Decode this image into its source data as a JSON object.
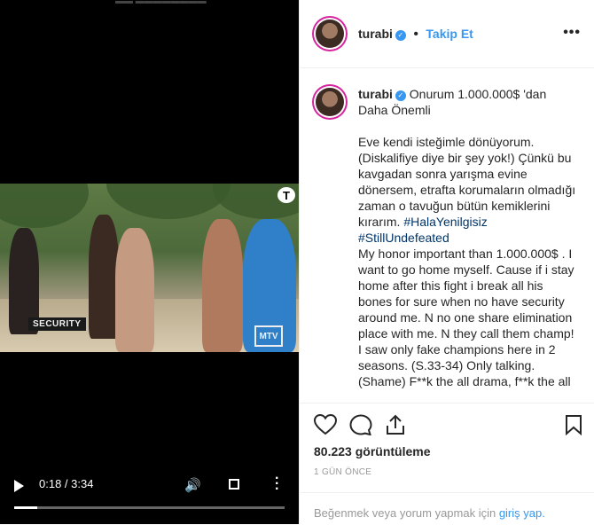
{
  "post": {
    "username": "turabi",
    "follow_label": "Takip Et",
    "more_label": "•••",
    "top_ghost_text": "▬▬ ▬▬▬▬▬▬▬▬"
  },
  "video": {
    "time": "0:18 / 3:34",
    "progress": 0.084,
    "overlay_tag": "SECURITY",
    "channel_logo": "MTV",
    "corner_logo": "T"
  },
  "caption": {
    "username": "turabi",
    "first_line": "Onurum 1.000.000$ 'dan\nDaha Önemli",
    "para1": "Eve kendi isteğimle dönüyorum. (Diskalifiye diye bir şey yok!) Çünkü bu kavgadan sonra yarışma evine dönersem, etrafta korumaların olmadığı zaman o tavuğun bütün kemiklerini kırarım.",
    "hashtag1": "#HalaYenilgisiz",
    "hashtag2": "#StillUndefeated",
    "para2": "My honor important than 1.000.000$ . I want to go home myself. Cause if i stay home after this fight i break all his bones for sure when no have security around me. N no one share elimination place with me. N they call them champ!",
    "para3": "I saw only fake champions here in 2 seasons. (S.33-34) Only talking. (Shame) F**k the all drama, f**k the all"
  },
  "stats": {
    "views": "80.223 görüntüleme",
    "date": "1 GÜN ÖNCE"
  },
  "login": {
    "text": "Beğenmek veya yorum yapmak için ",
    "link": "giriş yap."
  },
  "colors": {
    "accent": "#3897f0",
    "hashtag": "#003569",
    "muted": "#999999"
  }
}
